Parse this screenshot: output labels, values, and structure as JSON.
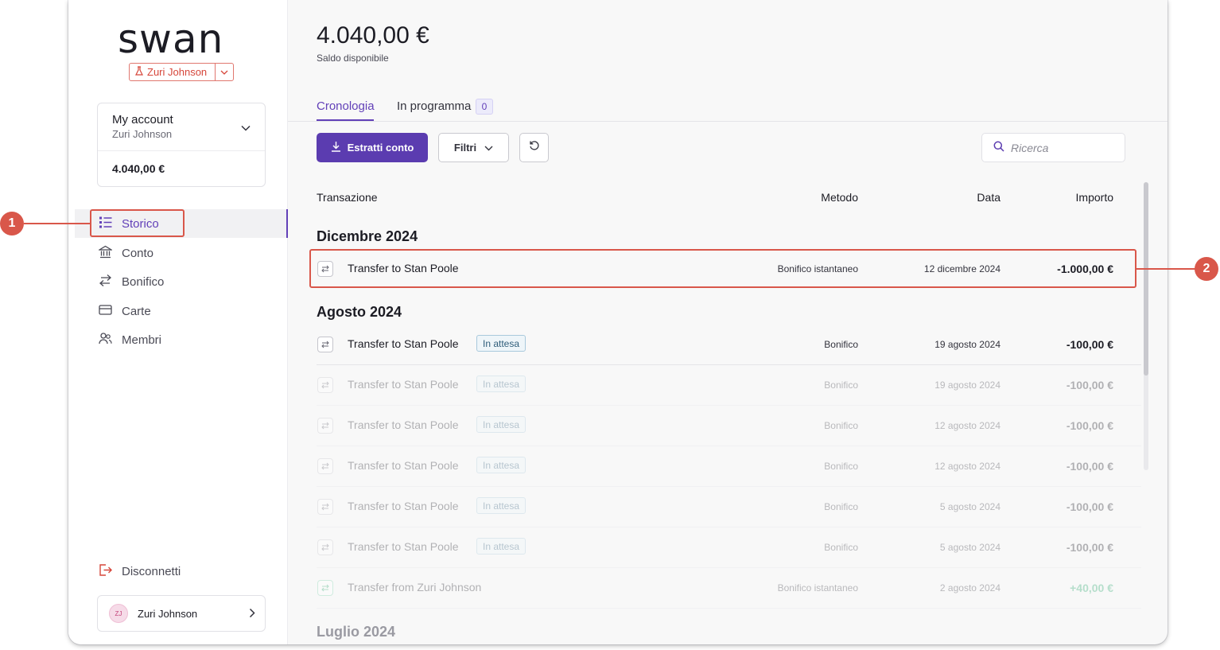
{
  "brand": {
    "logo_text": "swan",
    "env_user": "Zuri Johnson"
  },
  "account_card": {
    "title": "My account",
    "holder": "Zuri Johnson",
    "balance": "4.040,00 €"
  },
  "nav": [
    {
      "label": "Storico",
      "icon": "list-icon",
      "active": true
    },
    {
      "label": "Conto",
      "icon": "bank-icon",
      "active": false
    },
    {
      "label": "Bonifico",
      "icon": "transfer-arrows-icon",
      "active": false
    },
    {
      "label": "Carte",
      "icon": "card-icon",
      "active": false
    },
    {
      "label": "Membri",
      "icon": "people-icon",
      "active": false
    }
  ],
  "logout_label": "Disconnetti",
  "user": {
    "initials": "ZJ",
    "name": "Zuri Johnson"
  },
  "header": {
    "balance": "4.040,00 €",
    "balance_label": "Saldo disponibile"
  },
  "tabs": [
    {
      "label": "Cronologia",
      "active": true
    },
    {
      "label": "In programma",
      "count": "0"
    }
  ],
  "toolbar": {
    "statements_label": "Estratti conto",
    "filter_label": "Filtri",
    "search_placeholder": "Ricerca"
  },
  "columns": {
    "transaction": "Transazione",
    "method": "Metodo",
    "date": "Data",
    "amount": "Importo"
  },
  "groups": [
    {
      "title": "Dicembre 2024",
      "rows": [
        {
          "label": "Transfer to Stan Poole",
          "badge": "",
          "method": "Bonifico istantaneo",
          "date": "12 dicembre 2024",
          "amount": "-1.000,00 €",
          "faded": false,
          "positive": false
        }
      ]
    },
    {
      "title": "Agosto 2024",
      "rows": [
        {
          "label": "Transfer to Stan Poole",
          "badge": "In attesa",
          "method": "Bonifico",
          "date": "19 agosto 2024",
          "amount": "-100,00 €",
          "faded": false,
          "positive": false
        },
        {
          "label": "Transfer to Stan Poole",
          "badge": "In attesa",
          "method": "Bonifico",
          "date": "19 agosto 2024",
          "amount": "-100,00 €",
          "faded": true,
          "positive": false
        },
        {
          "label": "Transfer to Stan Poole",
          "badge": "In attesa",
          "method": "Bonifico",
          "date": "12 agosto 2024",
          "amount": "-100,00 €",
          "faded": true,
          "positive": false
        },
        {
          "label": "Transfer to Stan Poole",
          "badge": "In attesa",
          "method": "Bonifico",
          "date": "12 agosto 2024",
          "amount": "-100,00 €",
          "faded": true,
          "positive": false
        },
        {
          "label": "Transfer to Stan Poole",
          "badge": "In attesa",
          "method": "Bonifico",
          "date": "5 agosto 2024",
          "amount": "-100,00 €",
          "faded": true,
          "positive": false
        },
        {
          "label": "Transfer to Stan Poole",
          "badge": "In attesa",
          "method": "Bonifico",
          "date": "5 agosto 2024",
          "amount": "-100,00 €",
          "faded": true,
          "positive": false
        },
        {
          "label": "Transfer from Zuri Johnson",
          "badge": "",
          "method": "Bonifico istantaneo",
          "date": "2 agosto 2024",
          "amount": "+40,00 €",
          "faded": true,
          "positive": true
        }
      ]
    },
    {
      "title": "Luglio 2024",
      "rows": []
    }
  ],
  "callouts": [
    "1",
    "2"
  ],
  "colors": {
    "accent": "#5b3cb0",
    "highlight": "#d9574a",
    "positive": "#2aa86f"
  }
}
